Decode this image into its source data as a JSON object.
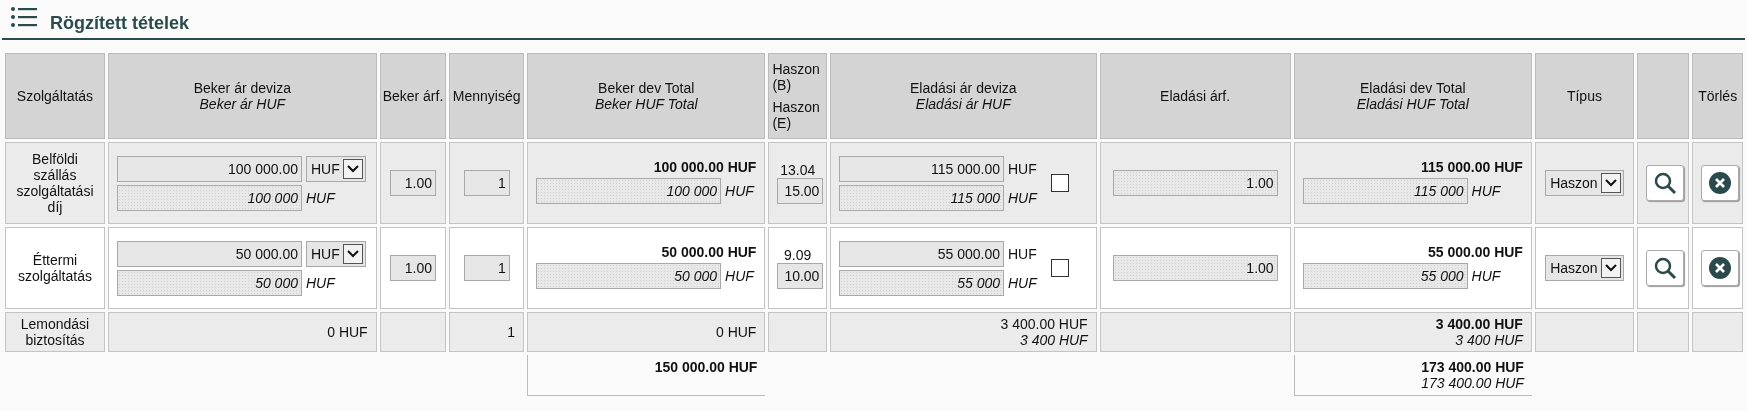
{
  "section": {
    "title": "Rögzített tételek"
  },
  "columns": [
    {
      "label": "Szolgáltatás"
    },
    {
      "label": "Beker ár deviza",
      "sub": "Beker ár HUF"
    },
    {
      "label": "Beker árf."
    },
    {
      "label": "Mennyiség"
    },
    {
      "label": "Beker dev Total",
      "sub": "Beker HUF Total"
    },
    {
      "label": "Haszon (B)",
      "sub2": "Haszon (E)"
    },
    {
      "label": "Eladási ár deviza",
      "sub": "Eladási ár HUF"
    },
    {
      "label": "Eladási árf."
    },
    {
      "label": "Eladási dev Total",
      "sub": "Eladási HUF Total"
    },
    {
      "label": "Típus"
    },
    {},
    {
      "label": "Törlés"
    }
  ],
  "rows": [
    {
      "kind": "item",
      "service": "Belföldi szállás szolgáltatási díj",
      "beker_deviza": "100 000.00",
      "beker_currency": "HUF",
      "beker_huf": "100 000",
      "beker_huf_unit": "HUF",
      "beker_arf": "1.00",
      "quantity": "1",
      "beker_dev_total": "100 000.00 HUF",
      "beker_huf_total": "100 000",
      "beker_huf_total_unit": "HUF",
      "haszon_b": "13.04",
      "haszon_e": "15.00",
      "eladasi_deviza": "115 000.00",
      "eladasi_currency": "HUF",
      "eladasi_huf": "115 000",
      "eladasi_huf_unit": "HUF",
      "checked": false,
      "eladasi_arf": "1.00",
      "eladasi_dev_total": "115 000.00 HUF",
      "eladasi_huf_total": "115 000",
      "eladasi_huf_total_unit": "HUF",
      "type": "Haszon"
    },
    {
      "kind": "item",
      "service": "Éttermi szolgáltatás",
      "beker_deviza": "50 000.00",
      "beker_currency": "HUF",
      "beker_huf": "50 000",
      "beker_huf_unit": "HUF",
      "beker_arf": "1.00",
      "quantity": "1",
      "beker_dev_total": "50 000.00 HUF",
      "beker_huf_total": "50 000",
      "beker_huf_total_unit": "HUF",
      "haszon_b": "9.09",
      "haszon_e": "10.00",
      "eladasi_deviza": "55 000.00",
      "eladasi_currency": "HUF",
      "eladasi_huf": "55 000",
      "eladasi_huf_unit": "HUF",
      "checked": false,
      "eladasi_arf": "1.00",
      "eladasi_dev_total": "55 000.00 HUF",
      "eladasi_huf_total": "55 000",
      "eladasi_huf_total_unit": "HUF",
      "type": "Haszon"
    },
    {
      "kind": "fee",
      "service": "Lemondási biztosítás",
      "beker": "0 HUF",
      "quantity": "1",
      "beker_total": "0 HUF",
      "sell_amount": "3 400.00 HUF",
      "sell_huf_amount": "3 400 HUF",
      "sell_total": "3 400.00 HUF",
      "sell_huf_total": "3 400 HUF"
    }
  ],
  "totals": {
    "beker_total": "150 000.00 HUF",
    "eladasi_dev_total": "173 400.00 HUF",
    "eladasi_huf_total": "173 400.00 HUF"
  }
}
